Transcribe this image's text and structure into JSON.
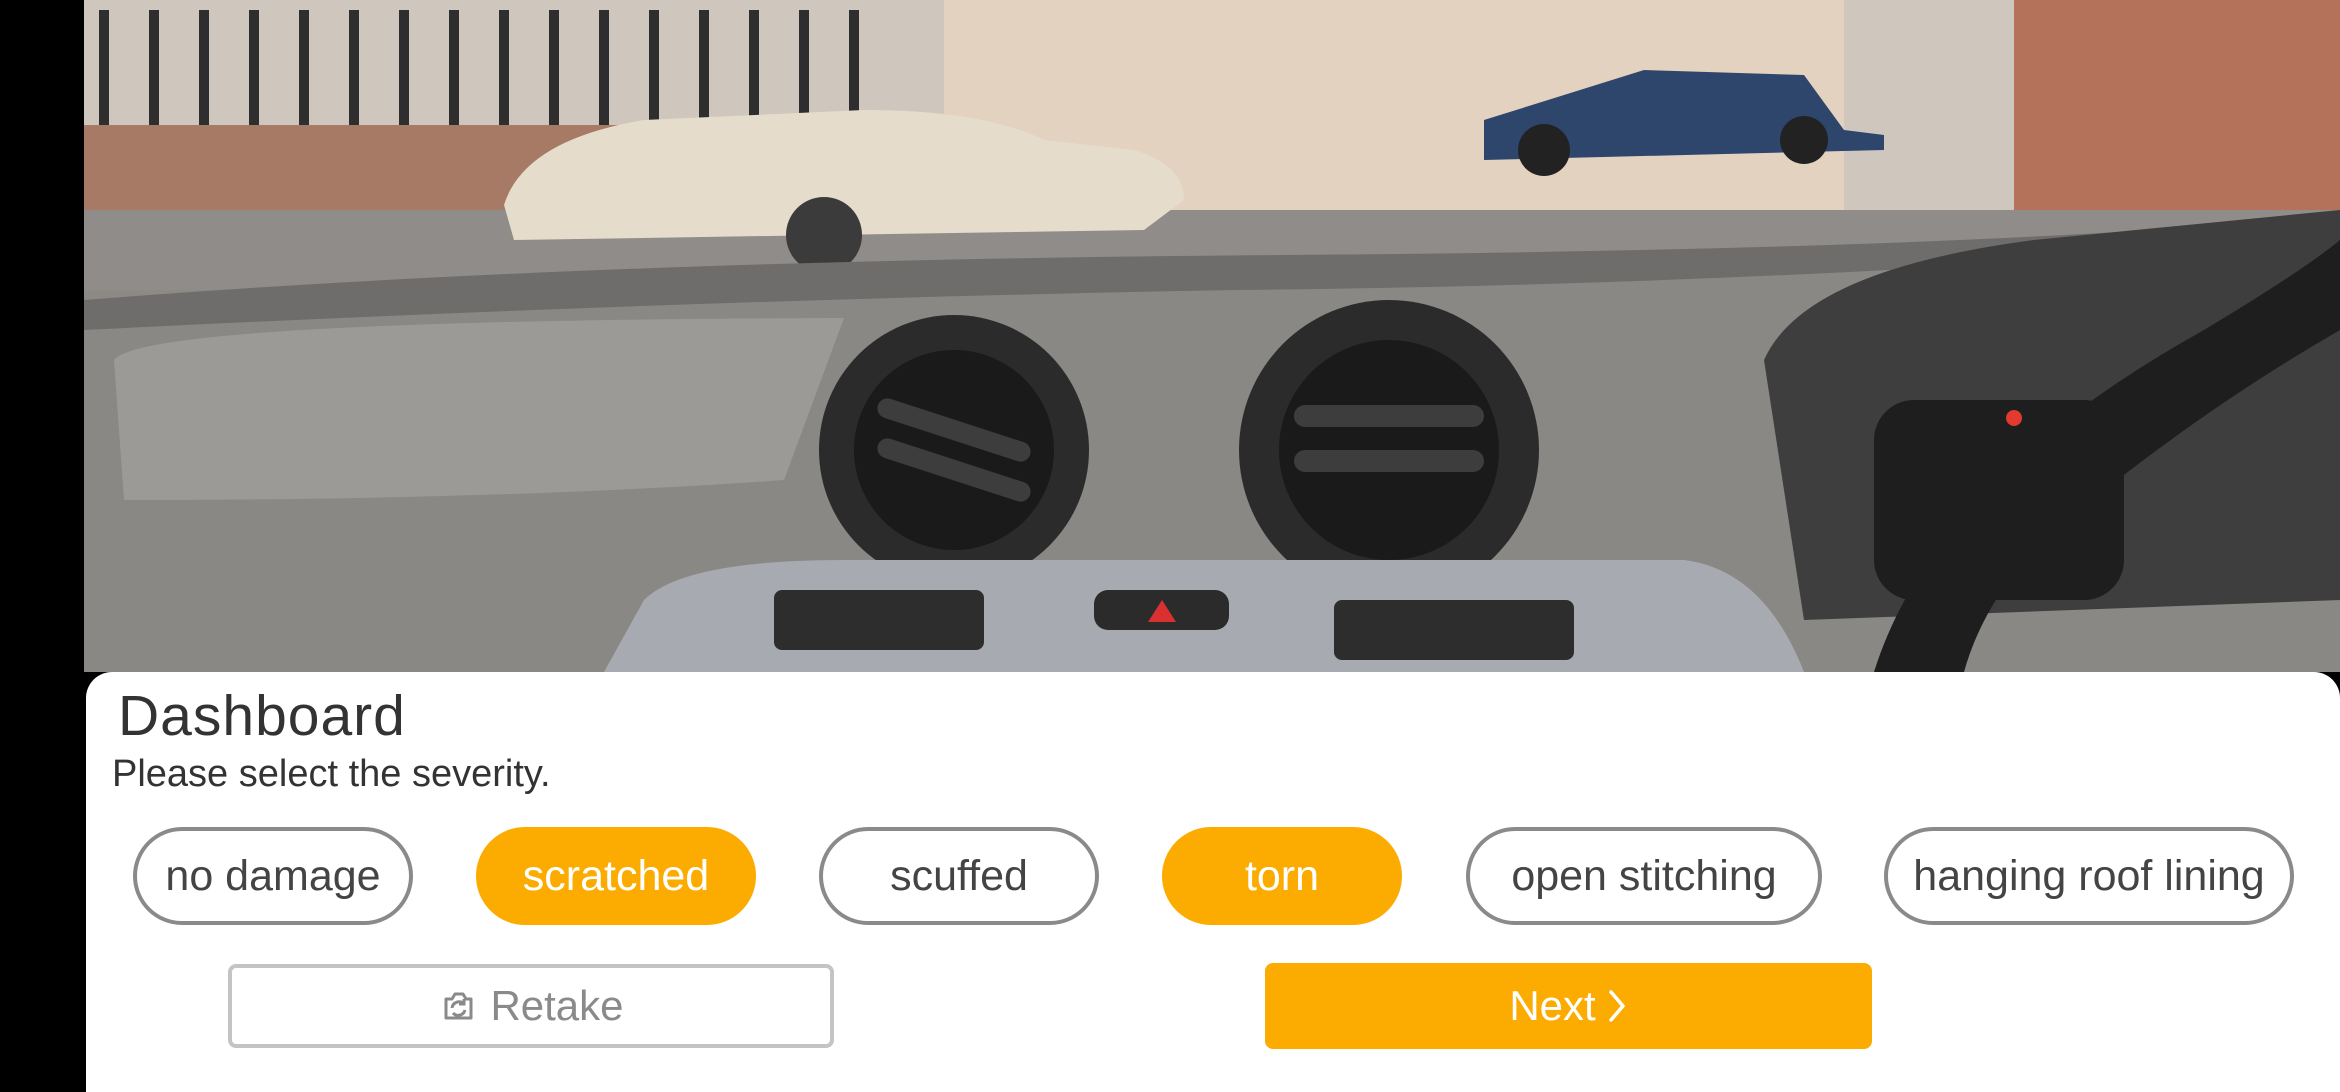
{
  "screen": {
    "title": "Dashboard",
    "subtitle": "Please select the severity."
  },
  "severity_options": [
    {
      "label": "no damage",
      "selected": false
    },
    {
      "label": "scratched",
      "selected": true
    },
    {
      "label": "scuffed",
      "selected": false
    },
    {
      "label": "torn",
      "selected": true
    },
    {
      "label": "open stitching",
      "selected": false
    },
    {
      "label": "hanging roof lining",
      "selected": false
    }
  ],
  "actions": {
    "retake_label": "Retake",
    "retake_icon": "camera-retake-icon",
    "next_label": "Next",
    "next_icon": "chevron-right-icon"
  },
  "colors": {
    "accent": "#fcac00",
    "chip_border": "#8a8a8a",
    "text": "#333333"
  }
}
